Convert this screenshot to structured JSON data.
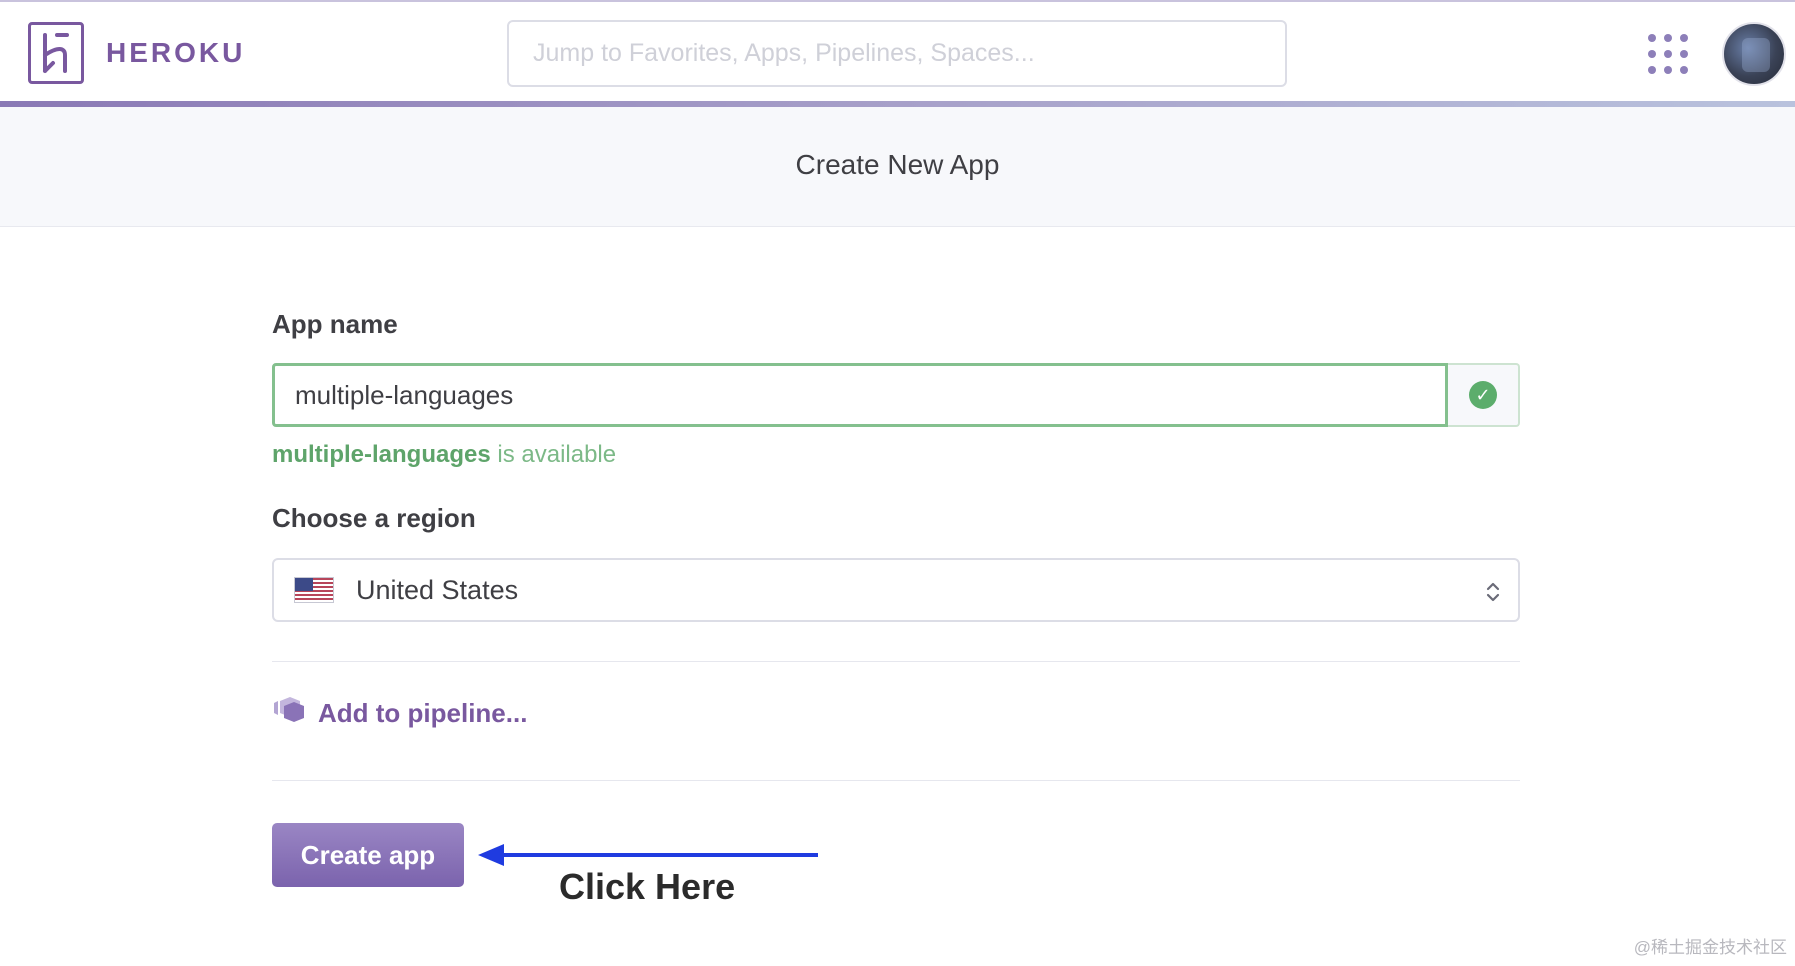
{
  "header": {
    "logo_text": "HEROKU",
    "search_placeholder": "Jump to Favorites, Apps, Pipelines, Spaces..."
  },
  "page_title": "Create New App",
  "form": {
    "app_name_label": "App name",
    "app_name_value": "multiple-languages",
    "availability_name": "multiple-languages",
    "availability_suffix": " is available",
    "region_label": "Choose a region",
    "region_value": "United States",
    "pipeline_label": "Add to pipeline...",
    "create_button_label": "Create app"
  },
  "annotation": {
    "click_here": "Click Here"
  },
  "watermark": "@稀土掘金技术社区",
  "colors": {
    "brand": "#79589f",
    "success": "#5cad6c",
    "annotation_arrow": "#1f3be0"
  },
  "icons": {
    "logo": "heroku-logo-icon",
    "apps": "apps-grid-icon",
    "valid": "check-circle-icon",
    "flag": "us-flag-icon",
    "chevron": "chevron-up-down-icon",
    "pipeline": "pipeline-icon"
  }
}
